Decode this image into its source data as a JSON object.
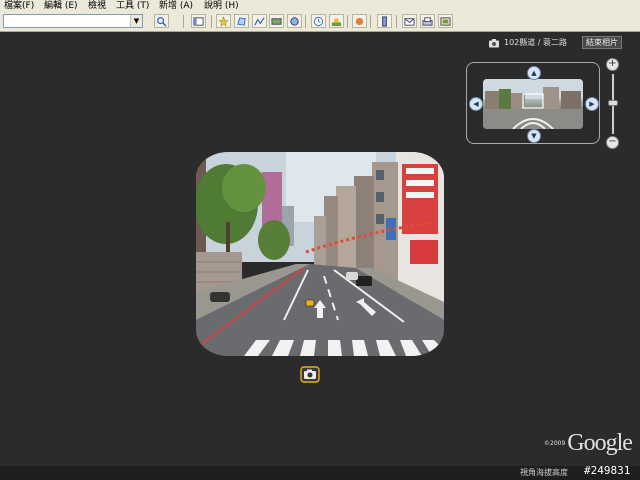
{
  "menu": {
    "items": [
      {
        "label": "檔案(F)"
      },
      {
        "label": "編輯 (E)"
      },
      {
        "label": "檢視"
      },
      {
        "label": "工具 (T)"
      },
      {
        "label": "新增 (A)"
      },
      {
        "label": "說明 (H)"
      }
    ]
  },
  "toolbar": {
    "search_value": "",
    "icons": [
      "search-icon",
      "sidebar-icon",
      "placemark-icon",
      "polygon-icon",
      "path-icon",
      "image-overlay-icon",
      "tour-icon",
      "historical-imagery-icon",
      "sun-icon",
      "planets-icon",
      "ruler-icon",
      "email-icon",
      "print-icon",
      "save-image-icon"
    ]
  },
  "photo_view": {
    "location": "102縣道 / 蓑二路",
    "exit_label": "結束相片"
  },
  "footer": {
    "copyright_year": "©2009",
    "logo_text": "Google",
    "altitude_label": "視角海拔高度",
    "post_number": "#249831"
  },
  "colors": {
    "background": "#2b2b2b",
    "menu_bg": "#ece9d8",
    "navigator_accent": "#d9e6f2"
  }
}
